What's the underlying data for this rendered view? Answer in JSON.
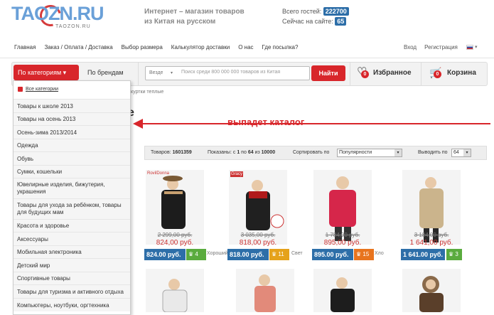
{
  "header": {
    "logo_text": "TAOZN.RU",
    "logo_sub": "TAOZON.RU",
    "tagline_line1": "Интернет – магазин товаров",
    "tagline_line2": "из Китая на русском",
    "guests_label": "Всего гостей:",
    "guests_value": "222700",
    "online_label": "Сейчас на сайте:",
    "online_value": "65"
  },
  "topnav": {
    "items": [
      "Главная",
      "Заказ / Оплата / Доставка",
      "Выбор размера",
      "Калькулятор доставки",
      "О нас",
      "Где посылка?"
    ],
    "login": "Вход",
    "register": "Регистрация"
  },
  "searchbar": {
    "by_category": "По категориям",
    "by_brand": "По брендам",
    "select_value": "Везде",
    "placeholder": "Поиск среди 800 000 000 товаров из Китая",
    "find_button": "Найти",
    "favorites_label": "Избранное",
    "favorites_count": "0",
    "cart_label": "Корзина",
    "cart_count": "0"
  },
  "breadcrumb": "куртки теплые",
  "page_title_peek": "е",
  "annotation": "выпадет каталог",
  "toolbar": {
    "goods_label": "Товаров:",
    "goods_value": "1601359",
    "shown_label": "Показаны: с",
    "shown_from": "1",
    "shown_to_label": "по",
    "shown_to": "64",
    "shown_of_label": "из",
    "shown_total": "10000",
    "sort_label": "Сортировать по",
    "sort_value": "Популярности",
    "per_page_label": "Выводить по",
    "per_page_value": "64"
  },
  "catalog": {
    "all_label": "Все категории",
    "items": [
      "Товары к школе 2013",
      "Товары на осень 2013",
      "Осень-зима 2013/2014",
      "Одежда",
      "Обувь",
      "Сумки, кошельки",
      "Ювелирные изделия, бижутерия, украшения",
      "Товары для ухода за ребёнком, товары для будущих мам",
      "Красота и здоровье",
      "Аксессуары",
      "Мобильная электроника",
      "Детский мир",
      "Спортивные товары",
      "Товары для туризма и активного отдыха",
      "Компьютеры, ноутбуки, оргтехника"
    ]
  },
  "products": [
    {
      "brand": "RovilDonna",
      "old": "2 299,00 руб.",
      "new": "824,00 руб.",
      "price": "824.00 руб.",
      "bonus": "4",
      "bonus_color": "#5aab3e",
      "extra": "Хороший"
    },
    {
      "brand": "Gracy",
      "old": "3 035,00 руб.",
      "new": "818,00 руб.",
      "price": "818.00 руб.",
      "bonus": "11",
      "bonus_color": "#e5a21b",
      "extra": "Свет"
    },
    {
      "brand": "",
      "old": "1 784,00 руб.",
      "new": "895,00 руб.",
      "price": "895.00 руб.",
      "bonus": "15",
      "bonus_color": "#e8741e",
      "extra": "Хло"
    },
    {
      "brand": "",
      "old": "3 184,00 руб.",
      "new": "1 641,00 руб.",
      "price": "1 641.00 руб.",
      "bonus": "3",
      "bonus_color": "#5aab3e",
      "extra": ""
    }
  ],
  "colors": {
    "accent": "#d8262b",
    "price_blue": "#2d6ea8"
  }
}
